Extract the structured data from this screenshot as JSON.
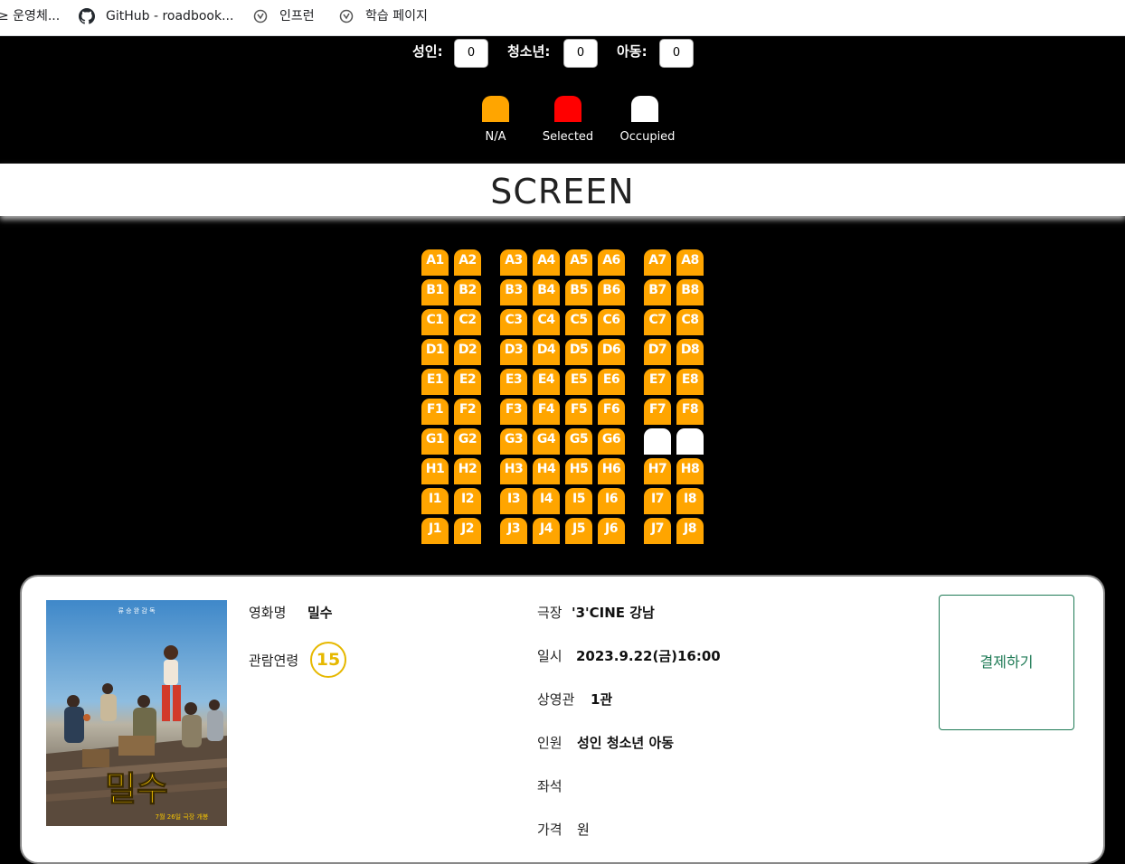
{
  "bookmarks": [
    {
      "label": "≥ 운영체...",
      "icon": "bookmark-text"
    },
    {
      "label": "GitHub - roadbook...",
      "icon": "github-icon"
    },
    {
      "label": "인프런",
      "icon": "inflearn-icon"
    },
    {
      "label": "학습 페이지",
      "icon": "inflearn-icon"
    }
  ],
  "tickets": {
    "adult_label": "성인:",
    "adult_count": "0",
    "teen_label": "청소년:",
    "teen_count": "0",
    "child_label": "아동:",
    "child_count": "0"
  },
  "legend": [
    {
      "label": "N/A",
      "color": "#ffa500"
    },
    {
      "label": "Selected",
      "color": "#ff0000"
    },
    {
      "label": "Occupied",
      "color": "#ffffff"
    }
  ],
  "screen_label": "SCREEN",
  "seats": {
    "rows": [
      "A",
      "B",
      "C",
      "D",
      "E",
      "F",
      "G",
      "H",
      "I",
      "J"
    ],
    "columns": [
      1,
      2,
      3,
      4,
      5,
      6,
      7,
      8
    ],
    "occupied": [
      "G7",
      "G8"
    ],
    "selected": [],
    "colors": {
      "available": "#ffa500",
      "selected": "#ff0000",
      "occupied": "#ffffff"
    }
  },
  "summary": {
    "movie_label": "영화명",
    "movie_value": "밀수",
    "age_label": "관람연령",
    "age_value": "15",
    "theater_label": "극장",
    "theater_value": "'3'CINE 강남",
    "date_label": "일시",
    "date_value": "2023.9.22(금)16:00",
    "hall_label": "상영관",
    "hall_value": "1관",
    "people_label": "인원",
    "people_value": "성인 청소년 아동",
    "seat_label": "좌석",
    "seat_value": "",
    "price_label": "가격",
    "price_value": "원",
    "pay_button": "결제하기"
  },
  "poster": {
    "top_text": "류 승 완 감 독",
    "title": "밀수",
    "release_text": "7월 26일 극장 개봉"
  }
}
